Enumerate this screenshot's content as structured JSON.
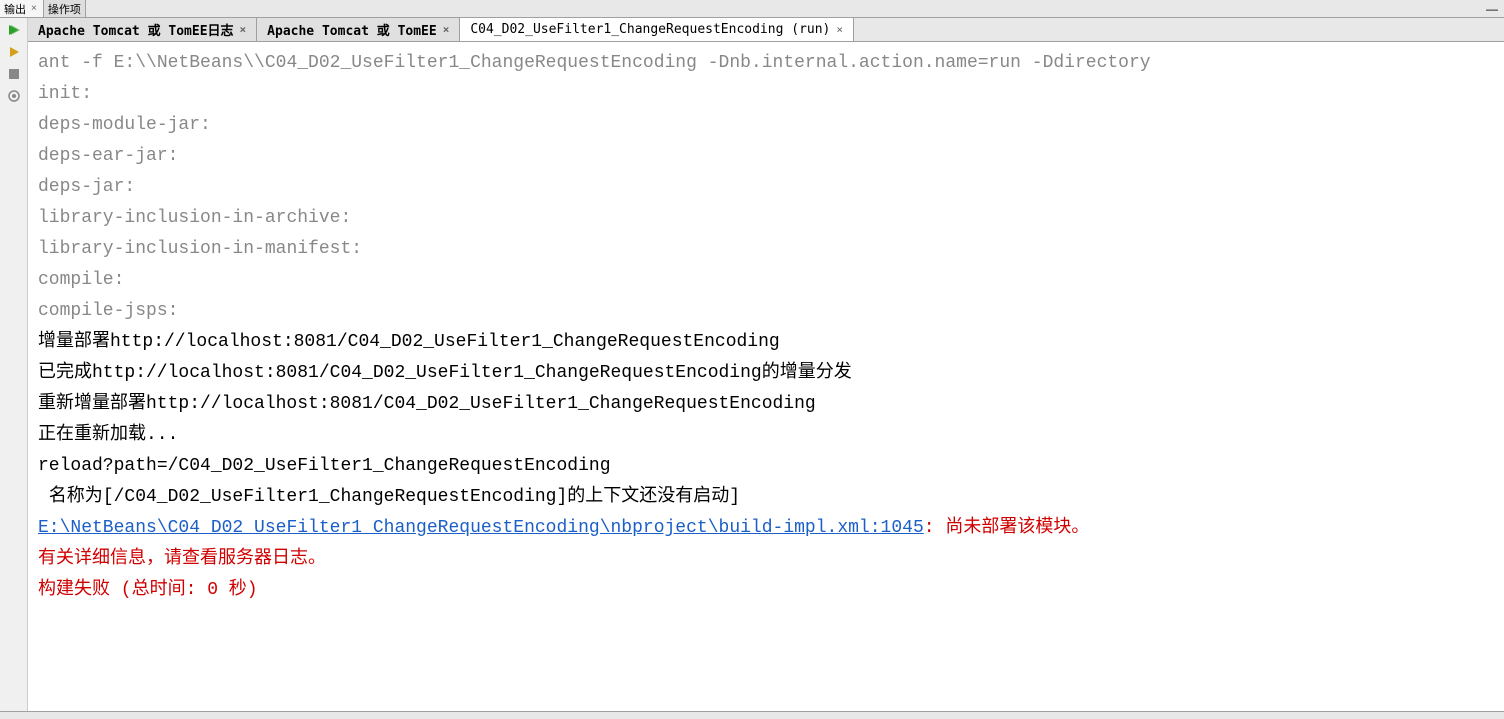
{
  "topTabs": [
    {
      "label": "输出",
      "active": true
    },
    {
      "label": "操作项",
      "active": false
    }
  ],
  "minimizeSymbol": "—",
  "innerTabs": [
    {
      "label": "Apache Tomcat 或 TomEE日志",
      "active": false,
      "bold": true
    },
    {
      "label": "Apache Tomcat 或 TomEE",
      "active": false,
      "bold": true
    },
    {
      "label": "C04_D02_UseFilter1_ChangeRequestEncoding (run)",
      "active": true,
      "bold": false
    }
  ],
  "closeSymbol": "×",
  "console": {
    "lines": [
      {
        "cls": "gray",
        "text": "ant -f E:\\\\NetBeans\\\\C04_D02_UseFilter1_ChangeRequestEncoding -Dnb.internal.action.name=run -Ddirectory"
      },
      {
        "cls": "gray",
        "text": "init:"
      },
      {
        "cls": "gray",
        "text": "deps-module-jar:"
      },
      {
        "cls": "gray",
        "text": "deps-ear-jar:"
      },
      {
        "cls": "gray",
        "text": "deps-jar:"
      },
      {
        "cls": "gray",
        "text": "library-inclusion-in-archive:"
      },
      {
        "cls": "gray",
        "text": "library-inclusion-in-manifest:"
      },
      {
        "cls": "gray",
        "text": "compile:"
      },
      {
        "cls": "gray",
        "text": "compile-jsps:"
      },
      {
        "cls": "black",
        "text": "增量部署http://localhost:8081/C04_D02_UseFilter1_ChangeRequestEncoding"
      },
      {
        "cls": "black",
        "text": "已完成http://localhost:8081/C04_D02_UseFilter1_ChangeRequestEncoding的增量分发"
      },
      {
        "cls": "black",
        "text": "重新增量部署http://localhost:8081/C04_D02_UseFilter1_ChangeRequestEncoding"
      },
      {
        "cls": "black",
        "text": "正在重新加载..."
      },
      {
        "cls": "black",
        "text": "reload?path=/C04_D02_UseFilter1_ChangeRequestEncoding"
      },
      {
        "cls": "black",
        "text": " 名称为[/C04_D02_UseFilter1_ChangeRequestEncoding]的上下文还没有启动]"
      }
    ],
    "errorLink": "E:\\NetBeans\\C04_D02_UseFilter1_ChangeRequestEncoding\\nbproject\\build-impl.xml:1045",
    "errorColon": ":",
    "errorMsg": " 尚未部署该模块。",
    "errorDetail": "有关详细信息，请查看服务器日志。",
    "buildFail": "构建失败 (总时间: 0 秒)"
  }
}
